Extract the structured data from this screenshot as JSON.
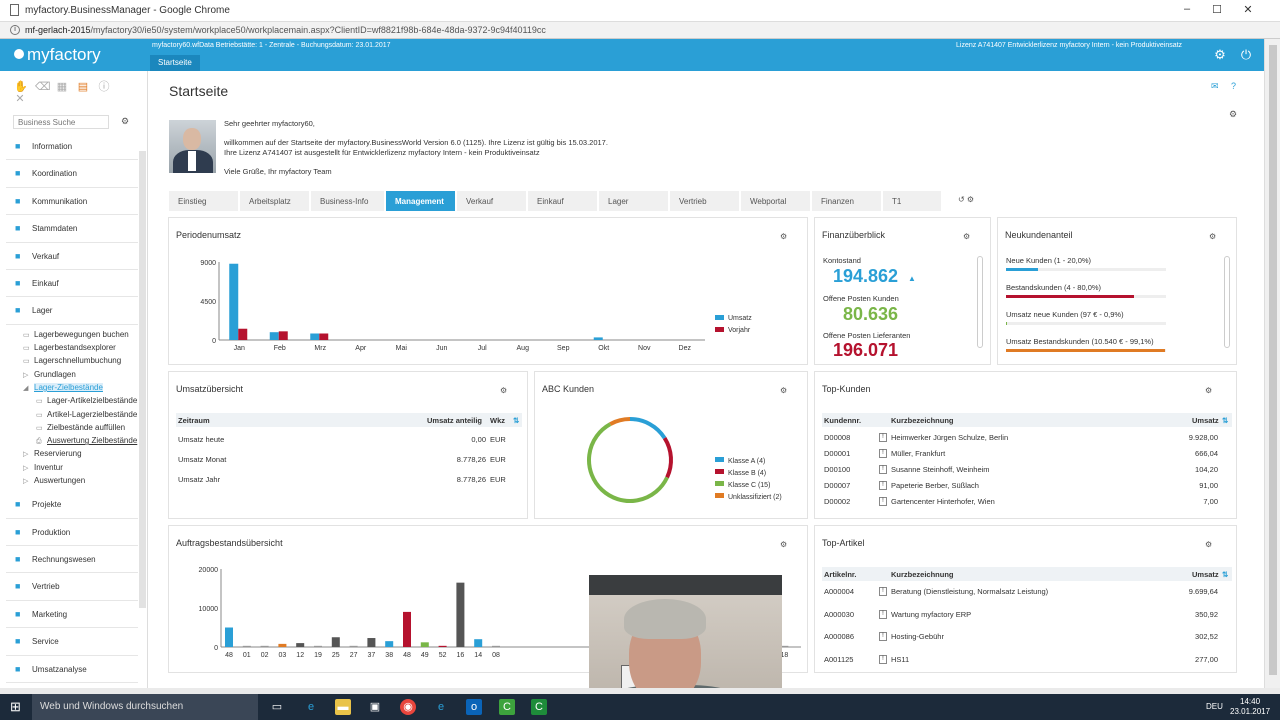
{
  "browser": {
    "title": "myfactory.BusinessManager - Google Chrome",
    "url_host": "mf-gerlach-2015",
    "url_path": "/myfactory30/ie50/system/workplace50/workplacemain.aspx?ClientID=wf8821f98b-684e-48da-9372-9c94f40119cc",
    "minimize": "‒",
    "maximize": "☐",
    "close": "✕"
  },
  "header": {
    "logo": "myfactory",
    "info": "myfactory60.wfData Betriebstätte: 1 - Zentrale - Buchungsdatum: 23.01.2017",
    "license": "Lizenz A741407 Entwicklerlizenz myfactory Intern - kein Produktiveinsatz",
    "tab": "Startseite"
  },
  "sidebar": {
    "search_placeholder": "Business Suche",
    "nav_top": [
      "Information",
      "Koordination",
      "Kommunikation",
      "Stammdaten",
      "Verkauf",
      "Einkauf",
      "Lager"
    ],
    "lager_tree": [
      {
        "label": "Lagerbewegungen buchen",
        "level": 1,
        "icon": "page"
      },
      {
        "label": "Lagerbestandsexplorer",
        "level": 1,
        "icon": "page"
      },
      {
        "label": "Lagerschnellumbuchung",
        "level": 1,
        "icon": "page"
      },
      {
        "label": "Grundlagen",
        "level": 1,
        "icon": "expand"
      },
      {
        "label": "Lager-Zielbestände",
        "level": 1,
        "icon": "collapse",
        "selected": true
      },
      {
        "label": "Lager-Artikelzielbestände",
        "level": 2,
        "icon": "page"
      },
      {
        "label": "Artikel-Lagerzielbestände",
        "level": 2,
        "icon": "page"
      },
      {
        "label": "Zielbestände auffüllen",
        "level": 2,
        "icon": "page"
      },
      {
        "label": "Auswertung Zielbestände",
        "level": 2,
        "icon": "print",
        "underline": true
      },
      {
        "label": "Reservierung",
        "level": 1,
        "icon": "expand"
      },
      {
        "label": "Inventur",
        "level": 1,
        "icon": "expand"
      },
      {
        "label": "Auswertungen",
        "level": 1,
        "icon": "expand"
      }
    ],
    "nav_bottom": [
      "Projekte",
      "Produktion",
      "Rechnungswesen",
      "Vertrieb",
      "Marketing",
      "Service",
      "Umsatzanalyse"
    ]
  },
  "page": {
    "title": "Startseite",
    "welcome": [
      "Sehr geehrter myfactory60,",
      "",
      "willkommen auf der Startseite der myfactory.BusinessWorld Version 6.0 (1125). Ihre Lizenz ist gültig bis 15.03.2017.",
      "Ihre Lizenz A741407 ist ausgestellt für Entwicklerlizenz myfactory Intern - kein Produktiveinsatz",
      "",
      "Viele Grüße, Ihr myfactory Team"
    ],
    "tabs": [
      "Einstieg",
      "Arbeitsplatz",
      "Business-Info",
      "Management",
      "Verkauf",
      "Einkauf",
      "Lager",
      "Vertrieb",
      "Webportal",
      "Finanzen",
      "T1"
    ],
    "active_tab": "Management"
  },
  "periodenumsatz": {
    "title": "Periodenumsatz",
    "legend": [
      "Umsatz",
      "Vorjahr"
    ]
  },
  "finanz": {
    "title": "Finanzüberblick",
    "kontostand_label": "Kontostand",
    "kontostand": "194.862",
    "op_kunden_label": "Offene Posten Kunden",
    "op_kunden": "80.636",
    "op_lief_label": "Offene Posten Lieferanten",
    "op_lief": "196.071",
    "colors": {
      "kontostand": "#2a9fd6",
      "kunden": "#7ab648",
      "lief": "#b5122e"
    }
  },
  "neukunden": {
    "title": "Neukundenanteil",
    "rows": [
      {
        "label": "Neue Kunden (1 - 20,0%)",
        "fraction": 0.2,
        "color": "#2a9fd6"
      },
      {
        "label": "Bestandskunden (4 - 80,0%)",
        "fraction": 0.8,
        "color": "#b5122e"
      },
      {
        "label": "Umsatz neue Kunden (97 € - 0,9%)",
        "fraction": 0.009,
        "color": "#7ab648"
      },
      {
        "label": "Umsatz Bestandskunden (10.540 € - 99,1%)",
        "fraction": 0.991,
        "color": "#e07b24"
      }
    ]
  },
  "umsatz": {
    "title": "Umsatzübersicht",
    "headers": [
      "Zeitraum",
      "Umsatz anteilig",
      "Wkz"
    ],
    "rows": [
      [
        "Umsatz heute",
        "0,00",
        "EUR"
      ],
      [
        "Umsatz Monat",
        "8.778,26",
        "EUR"
      ],
      [
        "Umsatz Jahr",
        "8.778,26",
        "EUR"
      ]
    ]
  },
  "abc": {
    "title": "ABC Kunden",
    "legend": [
      "Klasse A (4)",
      "Klasse B (4)",
      "Klasse C (15)",
      "Unklassifiziert (2)"
    ]
  },
  "topkunden": {
    "title": "Top-Kunden",
    "headers": [
      "Kundennr.",
      "Kurzbezeichnung",
      "Umsatz"
    ],
    "rows": [
      [
        "D00008",
        "Heimwerker Jürgen Schulze, Berlin",
        "9.928,00"
      ],
      [
        "D00001",
        "Müller, Frankfurt",
        "666,04"
      ],
      [
        "D00100",
        "Susanne Steinhoff, Weinheim",
        "104,20"
      ],
      [
        "D00007",
        "Papeterie Berber, Süßlach",
        "91,00"
      ],
      [
        "D00002",
        "Gartencenter Hinterhofer, Wien",
        "7,00"
      ]
    ]
  },
  "auftrag": {
    "title": "Auftragsbestandsübersicht"
  },
  "topartikel": {
    "title": "Top-Artikel",
    "headers": [
      "Artikelnr.",
      "Kurzbezeichnung",
      "Umsatz"
    ],
    "rows": [
      [
        "A000004",
        "Beratung (Dienstleistung, Normalsatz Leistung)",
        "9.699,64"
      ],
      [
        "A000030",
        "Wartung myfactory ERP",
        "350,92"
      ],
      [
        "A000086",
        "Hosting-Gebühr",
        "302,52"
      ],
      [
        "A001125",
        "HS11",
        "277,00"
      ]
    ]
  },
  "taskbar": {
    "search": "Web und Windows durchsuchen",
    "lang": "DEU",
    "time": "14:40",
    "date": "23.01.2017"
  },
  "chart_data": [
    {
      "type": "bar",
      "title": "Periodenumsatz",
      "categories": [
        "Jan",
        "Feb",
        "Mrz",
        "Apr",
        "Mai",
        "Jun",
        "Jul",
        "Aug",
        "Sep",
        "Okt",
        "Nov",
        "Dez"
      ],
      "series": [
        {
          "name": "Umsatz",
          "color": "#2a9fd6",
          "values": [
            8800,
            900,
            750,
            0,
            0,
            0,
            0,
            0,
            0,
            300,
            0,
            0
          ]
        },
        {
          "name": "Vorjahr",
          "color": "#b5122e",
          "values": [
            1300,
            1000,
            750,
            0,
            0,
            0,
            0,
            0,
            0,
            0,
            0,
            0
          ]
        }
      ],
      "yticks": [
        0,
        4500,
        9000
      ],
      "ylim": [
        0,
        9000
      ],
      "legend": "right"
    },
    {
      "type": "pie",
      "title": "ABC Kunden",
      "categories": [
        "Klasse A (4)",
        "Klasse B (4)",
        "Klasse C (15)",
        "Unklassifiziert (2)"
      ],
      "values": [
        4,
        4,
        15,
        2
      ],
      "colors": [
        "#2a9fd6",
        "#b5122e",
        "#7ab648",
        "#e07b24"
      ]
    },
    {
      "type": "bar",
      "title": "Auftragsbestandsübersicht",
      "categories": [
        "48",
        "01",
        "02",
        "03",
        "12",
        "19",
        "25",
        "27",
        "37",
        "38",
        "48",
        "49",
        "52",
        "16",
        "14",
        "08",
        "18",
        "03"
      ],
      "values": [
        5000,
        300,
        300,
        800,
        1000,
        300,
        2500,
        300,
        2300,
        1500,
        9000,
        1200,
        300,
        16500,
        2000,
        300,
        300,
        1800
      ],
      "colors": [
        "#2a9fd6",
        "#999999",
        "#999999",
        "#e07b24",
        "#555555",
        "#999999",
        "#555555",
        "#999999",
        "#555555",
        "#2a9fd6",
        "#b5122e",
        "#7ab648",
        "#b5122e",
        "#555555",
        "#2a9fd6",
        "#999999",
        "#999999",
        "#555555"
      ],
      "yticks": [
        0,
        10000,
        20000
      ],
      "ylim": [
        0,
        20000
      ]
    }
  ]
}
